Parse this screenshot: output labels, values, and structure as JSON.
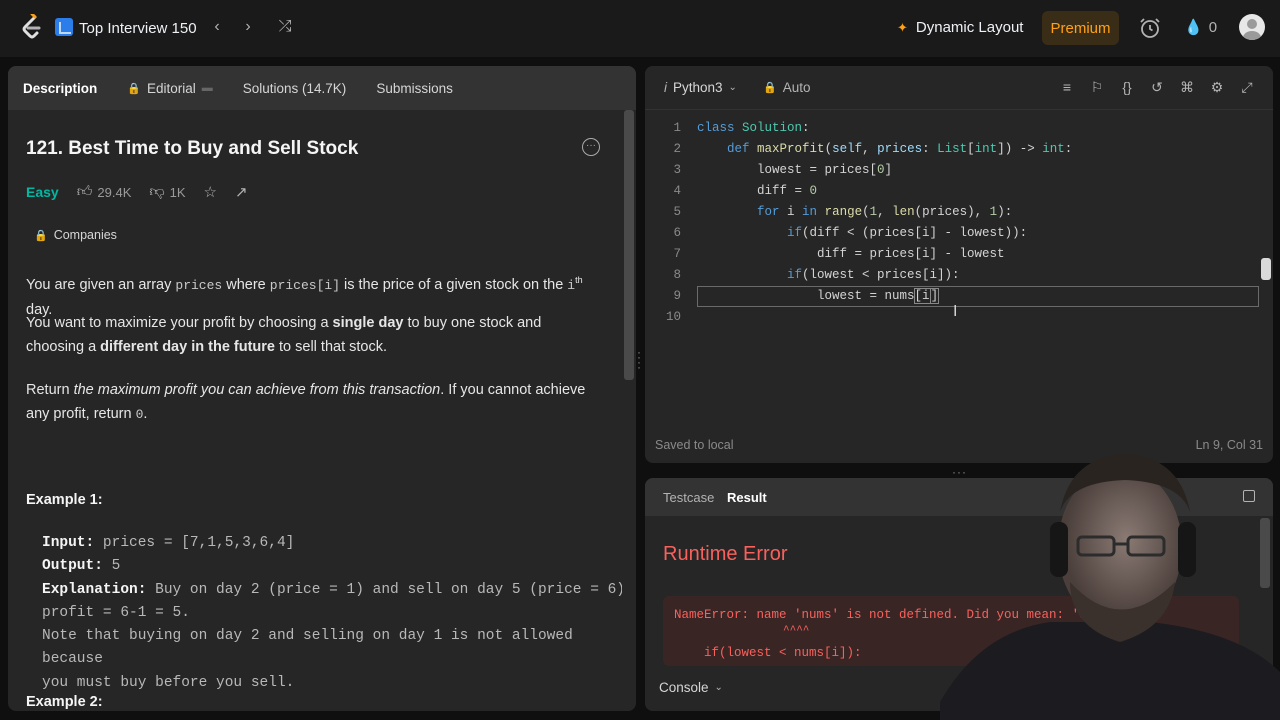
{
  "topbar": {
    "problem_list_title": "Top Interview 150",
    "prev_icon": "‹",
    "next_icon": "›",
    "shuffle_icon": "⤮",
    "dynamic_layout": "Dynamic Layout",
    "premium": "Premium",
    "streak_count": "0"
  },
  "tabs": {
    "description": "Description",
    "editorial": "Editorial",
    "solutions": "Solutions (14.7K)",
    "submissions": "Submissions"
  },
  "problem": {
    "title": "121. Best Time to Buy and Sell Stock",
    "difficulty": "Easy",
    "likes": "29.4K",
    "dislikes": "1K",
    "companies": "Companies",
    "p1": {
      "a": "You are given an array ",
      "code1": "prices",
      "b": " where ",
      "code2": "prices[i]",
      "c": " is the price of a given stock on the ",
      "code3": "i",
      "sup": "th",
      "d": " day."
    },
    "p2": {
      "a": "You want to maximize your profit by choosing a ",
      "b1": "single day",
      "c": " to buy one stock and choosing a ",
      "b2": "different day in the future",
      "d": " to sell that stock."
    },
    "p3": {
      "a": "Return ",
      "i1": "the maximum profit you can achieve from this transaction",
      "b": ". If you cannot achieve any profit, return ",
      "code1": "0",
      "c": "."
    },
    "example1_title": "Example 1:",
    "example1": {
      "input_label": "Input:",
      "input": " prices = [7,1,5,3,6,4]",
      "output_label": "Output:",
      "output": " 5",
      "explanation_label": "Explanation:",
      "explanation": " Buy on day 2 (price = 1) and sell on day 5 (price = 6),",
      "line2": "profit = 6-1 = 5.",
      "line3": "Note that buying on day 2 and selling on day 1 is not allowed because",
      "line4": "you must buy before you sell."
    },
    "example2_title": "Example 2:"
  },
  "editor": {
    "language": "Python3",
    "mode": "Auto",
    "saved_status": "Saved to local",
    "cursor_position": "Ln 9, Col 31",
    "line_numbers": [
      "1",
      "2",
      "3",
      "4",
      "5",
      "6",
      "7",
      "8",
      "9",
      "10"
    ]
  },
  "result": {
    "testcase_tab": "Testcase",
    "result_tab": "Result",
    "status": "Runtime Error",
    "error_line1": "NameError: name 'nums' is not defined. Did you mean: 'dum",
    "error_line2": "^^^^",
    "error_line3": "    if(lowest < nums[i]):",
    "console": "Console"
  },
  "colors": {
    "accent": "#ffa116",
    "easy": "#00b8a3",
    "error": "#f8615c"
  }
}
